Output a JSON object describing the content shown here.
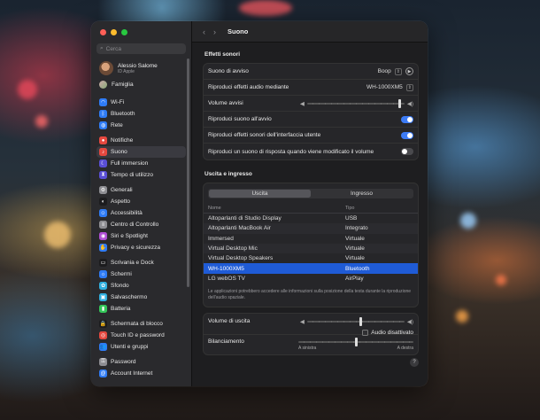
{
  "window": {
    "title": "Suono"
  },
  "sidebar": {
    "search_placeholder": "Cerca",
    "account": {
      "name": "Alessio Salome",
      "subtitle": "ID Apple"
    },
    "family": "Famiglia",
    "groups": [
      [
        {
          "label": "Wi-Fi",
          "icon": "wifi-icon",
          "color": "#2f7cf6",
          "glyph": "◠"
        },
        {
          "label": "Bluetooth",
          "icon": "bluetooth-icon",
          "color": "#2f7cf6",
          "glyph": "ᛒ"
        },
        {
          "label": "Rete",
          "icon": "network-icon",
          "color": "#2f7cf6",
          "glyph": "◍"
        }
      ],
      [
        {
          "label": "Notifiche",
          "icon": "notifications-icon",
          "color": "#e5483f",
          "glyph": "●"
        },
        {
          "label": "Suono",
          "icon": "sound-icon",
          "color": "#e5483f",
          "glyph": "♪",
          "active": true
        },
        {
          "label": "Full immersion",
          "icon": "focus-icon",
          "color": "#5a4fd6",
          "glyph": "☾"
        },
        {
          "label": "Tempo di utilizzo",
          "icon": "screen-time-icon",
          "color": "#5a4fd6",
          "glyph": "⧗"
        }
      ],
      [
        {
          "label": "Generali",
          "icon": "general-icon",
          "color": "#8e8e93",
          "glyph": "⚙"
        },
        {
          "label": "Aspetto",
          "icon": "appearance-icon",
          "color": "#1c1c1e",
          "glyph": "◐"
        },
        {
          "label": "Accessibilità",
          "icon": "accessibility-icon",
          "color": "#2f7cf6",
          "glyph": "☺"
        },
        {
          "label": "Centro di Controllo",
          "icon": "control-center-icon",
          "color": "#8e8e93",
          "glyph": "≡"
        },
        {
          "label": "Siri e Spotlight",
          "icon": "siri-icon",
          "color": "#b04fd6",
          "glyph": "◉"
        },
        {
          "label": "Privacy e sicurezza",
          "icon": "privacy-icon",
          "color": "#2f7cf6",
          "glyph": "✋"
        }
      ],
      [
        {
          "label": "Scrivania e Dock",
          "icon": "desktop-dock-icon",
          "color": "#1c1c1e",
          "glyph": "▭"
        },
        {
          "label": "Schermi",
          "icon": "displays-icon",
          "color": "#2f7cf6",
          "glyph": "☼"
        },
        {
          "label": "Sfondo",
          "icon": "wallpaper-icon",
          "color": "#30b0e0",
          "glyph": "✿"
        },
        {
          "label": "Salvaschermo",
          "icon": "screensaver-icon",
          "color": "#30b0e0",
          "glyph": "▣"
        },
        {
          "label": "Batteria",
          "icon": "battery-icon",
          "color": "#34c759",
          "glyph": "▮"
        }
      ],
      [
        {
          "label": "Schermata di blocco",
          "icon": "lock-screen-icon",
          "color": "#1c1c1e",
          "glyph": "🔒"
        },
        {
          "label": "Touch ID e password",
          "icon": "touch-id-icon",
          "color": "#e5483f",
          "glyph": "◎"
        },
        {
          "label": "Utenti e gruppi",
          "icon": "users-icon",
          "color": "#2f7cf6",
          "glyph": "👥"
        }
      ],
      [
        {
          "label": "Password",
          "icon": "password-icon",
          "color": "#8e8e93",
          "glyph": "⚿"
        },
        {
          "label": "Account Internet",
          "icon": "internet-accounts-icon",
          "color": "#2f7cf6",
          "glyph": "@"
        }
      ]
    ]
  },
  "effects": {
    "title": "Effetti sonori",
    "alert_sound_label": "Suono di avviso",
    "alert_sound_value": "Boop",
    "play_effects_label": "Riproduci effetti audio mediante",
    "play_effects_value": "WH-1000XM5",
    "alert_volume_label": "Volume avvisi",
    "alert_volume": 0.95,
    "startup_sound_label": "Riproduci suono all'avvio",
    "startup_sound_on": true,
    "ui_effects_label": "Riproduci effetti sonori dell'interfaccia utente",
    "ui_effects_on": true,
    "feedback_label": "Riproduci un suono di risposta quando viene modificato il volume",
    "feedback_on": false
  },
  "io": {
    "title": "Uscita e ingresso",
    "tab_output": "Uscita",
    "tab_input": "Ingresso",
    "col_name": "Nome",
    "col_type": "Tipo",
    "devices": [
      {
        "name": "Altoparlanti di Studio Display",
        "type": "USB"
      },
      {
        "name": "Altoparlanti MacBook Air",
        "type": "Integrato"
      },
      {
        "name": "Immersed",
        "type": "Virtuale"
      },
      {
        "name": "Virtual Desktop Mic",
        "type": "Virtuale"
      },
      {
        "name": "Virtual Desktop Speakers",
        "type": "Virtuale"
      },
      {
        "name": "WH-1000XM5",
        "type": "Bluetooth",
        "selected": true
      },
      {
        "name": "LG webOS TV",
        "type": "AirPlay"
      }
    ],
    "note": "Le applicazioni potrebbero accedere alle informazioni sulla posizione della testa durante la riproduzione dell'audio spaziale."
  },
  "output": {
    "volume_label": "Volume di uscita",
    "volume": 0.55,
    "mute_label": "Audio disattivato",
    "balance_label": "Bilanciamento",
    "balance": 0.5,
    "left_label": "A sinistra",
    "right_label": "A destra"
  },
  "help_label": "?"
}
